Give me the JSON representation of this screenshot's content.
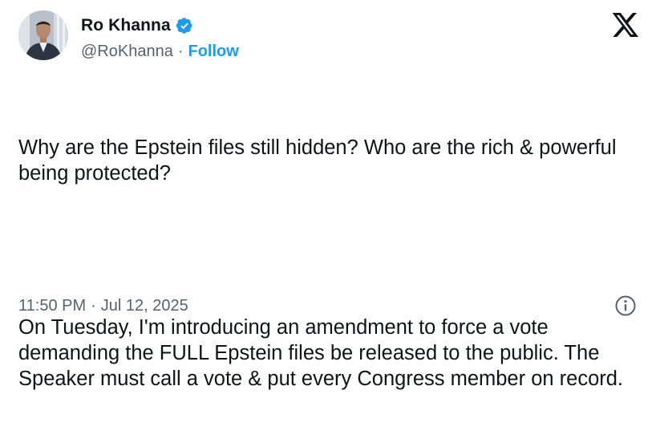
{
  "author": {
    "display_name": "Ro Khanna",
    "handle": "@RoKhanna",
    "separator": "·",
    "follow_label": "Follow",
    "avatar_icon": "profile-photo",
    "verified_icon": "verified-badge-icon"
  },
  "brand": {
    "logo_icon": "x-logo-icon"
  },
  "tweet": {
    "paragraph_1": "Why are the Epstein files still hidden? Who are the rich & powerful being protected?",
    "paragraph_2": "On Tuesday, I'm introducing an amendment to force a vote demanding the FULL Epstein files be released to the public. The Speaker must call a vote & put every Congress member on record."
  },
  "meta": {
    "time": "11:50 PM",
    "separator": "·",
    "date": "Jul 12, 2025",
    "info_icon": "info-icon"
  },
  "colors": {
    "text": "#0f1419",
    "secondary": "#536471",
    "accent": "#1d9bf0"
  }
}
